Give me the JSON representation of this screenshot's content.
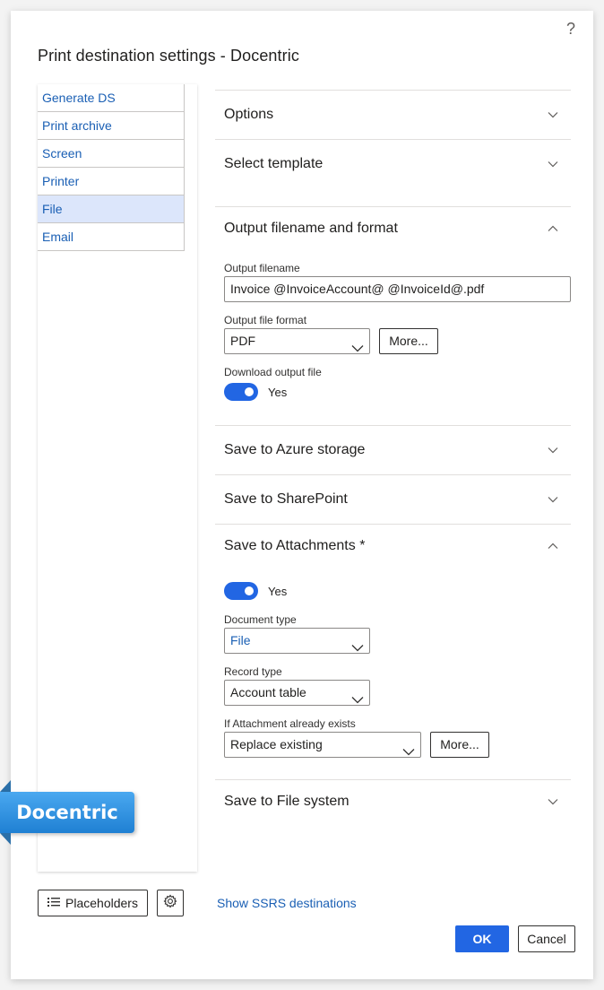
{
  "dialog": {
    "title": "Print destination settings - Docentric",
    "help": "?"
  },
  "nav": {
    "items": [
      {
        "label": "Generate DS",
        "active": false
      },
      {
        "label": "Print archive",
        "active": false
      },
      {
        "label": "Screen",
        "active": false
      },
      {
        "label": "Printer",
        "active": false
      },
      {
        "label": "File",
        "active": true
      },
      {
        "label": "Email",
        "active": false
      }
    ]
  },
  "sections": {
    "options": {
      "title": "Options",
      "expanded": false
    },
    "select_template": {
      "title": "Select template",
      "expanded": false
    },
    "output": {
      "title": "Output filename and format",
      "expanded": true,
      "filename_label": "Output filename",
      "filename_value": "Invoice @InvoiceAccount@ @InvoiceId@.pdf",
      "format_label": "Output file format",
      "format_value": "PDF",
      "more_label": "More...",
      "download_label": "Download output file",
      "download_toggle": "Yes"
    },
    "azure": {
      "title": "Save to Azure storage",
      "expanded": false
    },
    "sharepoint": {
      "title": "Save to SharePoint",
      "expanded": false
    },
    "attachments": {
      "title": "Save to Attachments *",
      "expanded": true,
      "toggle": "Yes",
      "doc_type_label": "Document type",
      "doc_type_value": "File",
      "record_type_label": "Record type",
      "record_type_value": "Account table",
      "exists_label": "If Attachment already exists",
      "exists_value": "Replace existing",
      "more_label": "More..."
    },
    "filesystem": {
      "title": "Save to File system",
      "expanded": false
    }
  },
  "footer": {
    "placeholders": "Placeholders",
    "ssrs_link": "Show SSRS destinations",
    "ok": "OK",
    "cancel": "Cancel"
  },
  "badge": {
    "text": "Docentric"
  },
  "colors": {
    "accent": "#2266e3",
    "link": "#1a5fb4",
    "nav_active": "#dce6fb",
    "badge": "#2b8ee0"
  }
}
